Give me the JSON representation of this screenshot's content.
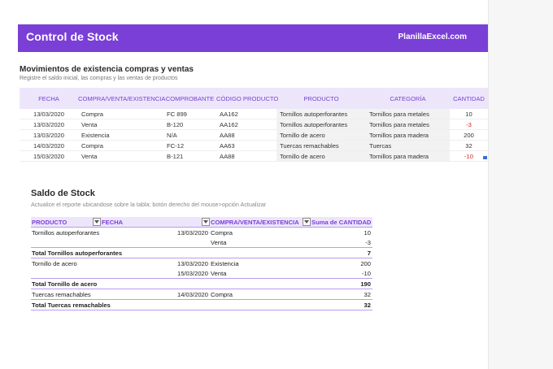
{
  "banner": {
    "title": "Control de Stock",
    "brand": "PlanillaExcel.com"
  },
  "section1": {
    "title": "Movimientos de existencia compras y ventas",
    "subtitle": "Registre el saldo inicial, las compras y las ventas de productos",
    "headers": [
      "FECHA",
      "COMPRA/VENTA/EXISTENCIA",
      "COMPROBANTE",
      "CÓDIGO PRODUCTO",
      "PRODUCTO",
      "CATEGORÍA",
      "CANTIDAD"
    ],
    "rows": [
      {
        "fecha": "13/03/2020",
        "tipo": "Compra",
        "comprobante": "FC 899",
        "codigo": "AA162",
        "producto": "Tornillos autoperforantes",
        "categoria": "Tornillos para metales",
        "cantidad": "10"
      },
      {
        "fecha": "13/03/2020",
        "tipo": "Venta",
        "comprobante": "B-120",
        "codigo": "AA162",
        "producto": "Tornillos autoperforantes",
        "categoria": "Tornillos para metales",
        "cantidad": "-3"
      },
      {
        "fecha": "13/03/2020",
        "tipo": "Existencia",
        "comprobante": "N/A",
        "codigo": "AA88",
        "producto": "Tornillo de acero",
        "categoria": "Tornillos para madera",
        "cantidad": "200"
      },
      {
        "fecha": "14/03/2020",
        "tipo": "Compra",
        "comprobante": "FC-12",
        "codigo": "AA63",
        "producto": "Tuercas remachables",
        "categoria": "Tuercas",
        "cantidad": "32"
      },
      {
        "fecha": "15/03/2020",
        "tipo": "Venta",
        "comprobante": "B-121",
        "codigo": "AA88",
        "producto": "Tornillo de acero",
        "categoria": "Tornillos para madera",
        "cantidad": "-10"
      }
    ]
  },
  "section2": {
    "title": "Saldo de Stock",
    "subtitle": "Actualice el reporte ubicandose sobre la tabla: botón derecho del mouse>opción Actualizar",
    "headers": {
      "producto": "PRODUCTO",
      "fecha": "FECHA",
      "tipo": "COMPRA/VENTA/EXISTENCIA",
      "suma": "Suma de CANTIDAD"
    },
    "rows": [
      {
        "producto": "Tornillos autoperforantes",
        "fecha": "13/03/2020",
        "tipo": "Compra",
        "suma": "10",
        "total": false
      },
      {
        "producto": "",
        "fecha": "",
        "tipo": "Venta",
        "suma": "-3",
        "total": false
      },
      {
        "producto": "Total Tornillos autoperforantes",
        "fecha": "",
        "tipo": "",
        "suma": "7",
        "total": true
      },
      {
        "producto": "Tornillo de acero",
        "fecha": "13/03/2020",
        "tipo": "Existencia",
        "suma": "200",
        "total": false
      },
      {
        "producto": "",
        "fecha": "15/03/2020",
        "tipo": "Venta",
        "suma": "-10",
        "total": false
      },
      {
        "producto": "Total Tornillo de acero",
        "fecha": "",
        "tipo": "",
        "suma": "190",
        "total": true
      },
      {
        "producto": "Tuercas remachables",
        "fecha": "14/03/2020",
        "tipo": "Compra",
        "suma": "32",
        "total": false
      },
      {
        "producto": "Total Tuercas remachables",
        "fecha": "",
        "tipo": "",
        "suma": "32",
        "total": true
      }
    ]
  },
  "colors": {
    "accent": "#7a3fd6",
    "header_bg": "#ede6fb",
    "negative": "#d61f1f"
  },
  "icons": {
    "filter": "filter-dropdown-icon"
  }
}
